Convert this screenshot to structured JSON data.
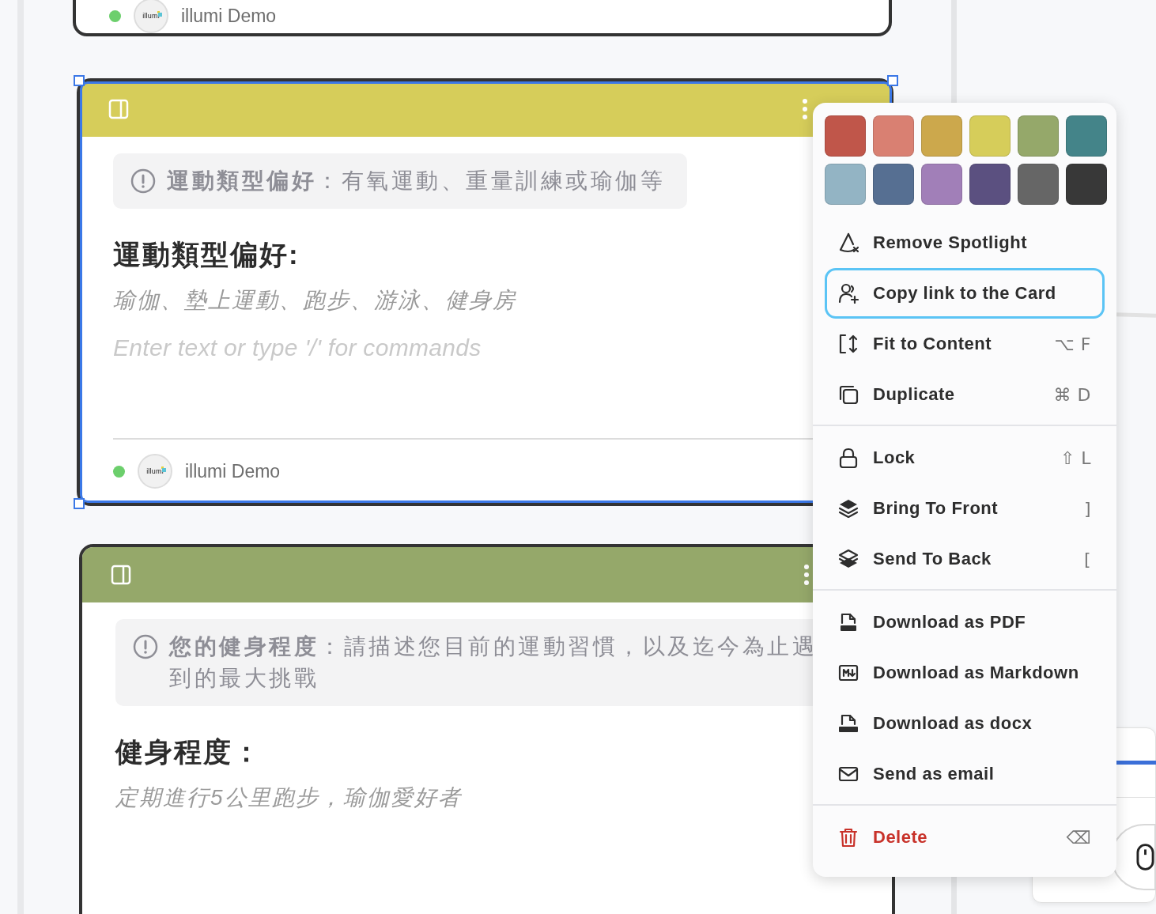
{
  "canvas": {
    "cards": [
      {
        "selected": false,
        "footer": {
          "online": true,
          "avatar_text": "illumi",
          "user": "illumi Demo"
        }
      },
      {
        "selected": true,
        "color": "#d6cd5a",
        "hint": "**運動類型偏好**：有氧運動、重量訓練或瑜伽等",
        "heading": "運動類型偏好:",
        "answer": "瑜伽、墊上運動、跑步、游泳、健身房",
        "placeholder": "Enter text or type '/' for commands",
        "footer": {
          "online": true,
          "avatar_text": "illumi",
          "user": "illumi Demo"
        }
      },
      {
        "selected": false,
        "color": "#95a86a",
        "hint": "**您的健身程度**：請描述您目前的運動習慣，以及迄今為止遇到的最大挑戰",
        "heading": "健身程度：",
        "answer": "定期進行5公里跑步，瑜伽愛好者"
      }
    ]
  },
  "context_menu": {
    "swatches": [
      {
        "color": "#c0564a"
      },
      {
        "color": "#d98072"
      },
      {
        "color": "#cca84c"
      },
      {
        "color": "#d6cd5a"
      },
      {
        "color": "#95a86a"
      },
      {
        "color": "#448489"
      },
      {
        "color": "#93b4c4"
      },
      {
        "color": "#566f92"
      },
      {
        "color": "#a17fb8"
      },
      {
        "color": "#5b5080"
      },
      {
        "color": "#666666"
      },
      {
        "color": "#383838"
      }
    ],
    "groups": [
      {
        "items": [
          {
            "label": "Remove Spotlight",
            "selected": false,
            "destructive": false
          },
          {
            "label": "Copy link to the Card",
            "selected": true,
            "destructive": false
          },
          {
            "label": "Fit to Content",
            "shortcut": "⌥ F",
            "selected": false,
            "destructive": false
          },
          {
            "label": "Duplicate",
            "shortcut": "⌘ D",
            "selected": false,
            "destructive": false
          }
        ]
      },
      {
        "items": [
          {
            "label": "Lock",
            "shortcut": "⇧ L",
            "selected": false,
            "destructive": false
          },
          {
            "label": "Bring To Front",
            "shortcut": "]",
            "selected": false,
            "destructive": false
          },
          {
            "label": "Send To Back",
            "shortcut": "[",
            "selected": false,
            "destructive": false
          }
        ]
      },
      {
        "items": [
          {
            "label": "Download as PDF",
            "selected": false,
            "destructive": false
          },
          {
            "label": "Download as Markdown",
            "selected": false,
            "destructive": false
          },
          {
            "label": "Download as docx",
            "selected": false,
            "destructive": false
          },
          {
            "label": "Send as email",
            "selected": false,
            "destructive": false
          }
        ]
      },
      {
        "items": [
          {
            "label": "Delete",
            "shortcut": "⌫",
            "selected": false,
            "destructive": true
          }
        ]
      }
    ]
  }
}
